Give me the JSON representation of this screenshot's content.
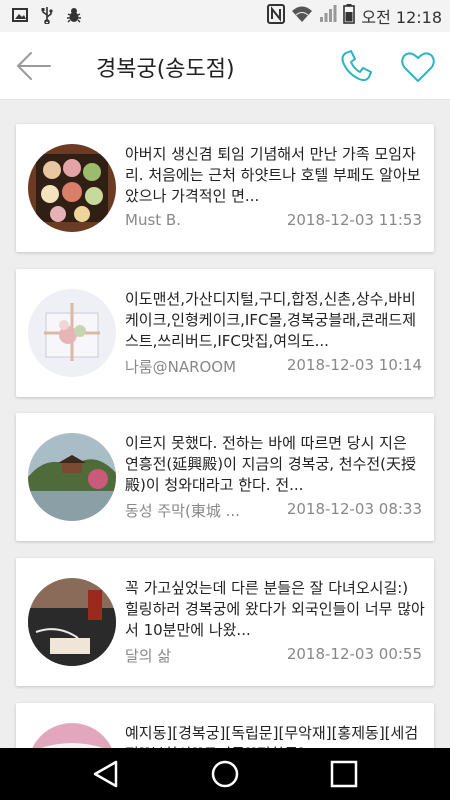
{
  "status": {
    "time": "오전 12:18",
    "left_icons": [
      "image-icon",
      "usb-icon",
      "bug-icon"
    ],
    "right_icons": [
      "nfc-icon",
      "wifi-icon",
      "signal-icon",
      "battery-icon"
    ]
  },
  "header": {
    "title": "경복궁(송도점)",
    "accent_color": "#2cb5c0"
  },
  "posts": [
    {
      "snippet": "아버지 생신겸 퇴임 기념해서 만난 가족 모임자리. 처음에는 근처 하얏트나 호텔 부페도 알아보았으나 가격적인 면...",
      "author": "Must B.",
      "date": "2018-12-03 11:53",
      "thumb": "food-platter"
    },
    {
      "snippet": "이도맨션,가산디지털,구디,합정,신촌,상수,바비케이크,인형케이크,IFC몰,경복궁블래,콘래드제스트,쓰리버드,IFC맛집,여의도...",
      "author": "나룸@NAROOM",
      "date": "2018-12-03 10:14",
      "thumb": "cake-box"
    },
    {
      "snippet": "이르지 못했다. 전하는 바에 따르면 당시 지은 연흥전(延興殿)이 지금의 경복궁, 천수전(天授殿)이 청와대라고 한다. 전...",
      "author": "동성 주막(東城 ...",
      "date": "2018-12-03 08:33",
      "thumb": "palace-pond"
    },
    {
      "snippet": "꼭 가고싶었는데 다른 분들은 잘 다녀오시길:) 힐링하러 경복궁에 왔다가 외국인들이 너무 많아서 10분만에 나왔...",
      "author": "달의 삶",
      "date": "2018-12-03 00:55",
      "thumb": "desk-drink"
    },
    {
      "snippet": "예지동][경복궁][독립문][무악재][홍제동][세검정][북한산][구기동][평창동]...",
      "author": "",
      "date": "",
      "thumb": "pink-poster"
    }
  ],
  "nav": {
    "buttons": [
      "back-triangle-icon",
      "home-circle-icon",
      "recents-square-icon"
    ]
  }
}
